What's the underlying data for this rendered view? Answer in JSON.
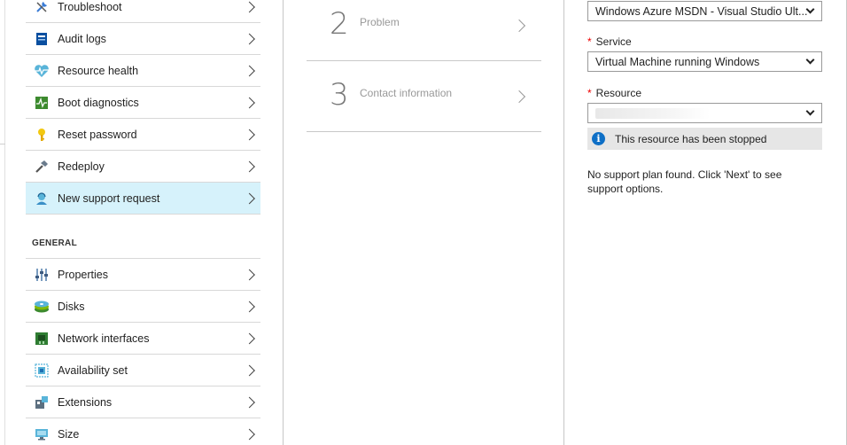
{
  "left_menu": {
    "items_top": [
      {
        "label": "Troubleshoot",
        "icon": "wrench-icon"
      },
      {
        "label": "Audit logs",
        "icon": "audit-log-icon"
      },
      {
        "label": "Resource health",
        "icon": "heart-pulse-icon"
      },
      {
        "label": "Boot diagnostics",
        "icon": "boot-diagnostics-icon"
      },
      {
        "label": "Reset password",
        "icon": "key-icon"
      },
      {
        "label": "Redeploy",
        "icon": "hammer-icon"
      },
      {
        "label": "New support request",
        "icon": "support-person-icon",
        "selected": true
      }
    ],
    "section_general": "GENERAL",
    "items_general": [
      {
        "label": "Properties",
        "icon": "properties-sliders-icon"
      },
      {
        "label": "Disks",
        "icon": "disks-icon"
      },
      {
        "label": "Network interfaces",
        "icon": "network-interface-icon"
      },
      {
        "label": "Availability set",
        "icon": "availability-set-icon"
      },
      {
        "label": "Extensions",
        "icon": "extensions-icon"
      },
      {
        "label": "Size",
        "icon": "monitor-size-icon"
      }
    ]
  },
  "steps": [
    {
      "number": "2",
      "title": "Problem"
    },
    {
      "number": "3",
      "title": "Contact information"
    }
  ],
  "form": {
    "subscription_value": "Windows Azure MSDN - Visual Studio Ult...",
    "service_label": "Service",
    "service_value": "Virtual Machine running Windows",
    "resource_label": "Resource",
    "required_marker": "*",
    "info_message": "This resource has been stopped",
    "note": "No support plan found. Click 'Next' to see support options."
  },
  "colors": {
    "selected_bg": "#d6f2fb",
    "info_icon": "#0e6fc6",
    "required": "#e00000"
  }
}
